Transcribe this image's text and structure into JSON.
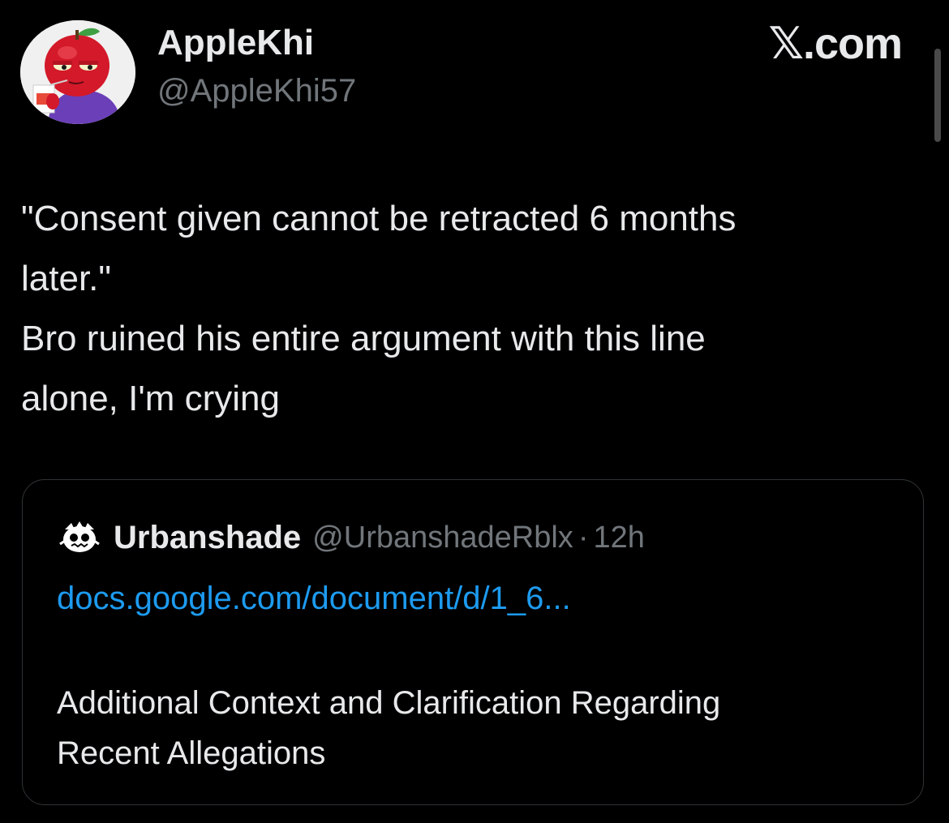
{
  "watermark": "𝕏.com",
  "author": {
    "display_name": "AppleKhi",
    "handle": "@AppleKhi57",
    "avatar_icon": "apple-character-avatar"
  },
  "tweet": {
    "lines": [
      "\"Consent given cannot be retracted 6 months",
      "later.\"",
      "Bro ruined his entire argument with this line",
      "alone, I'm crying"
    ]
  },
  "quoted_tweet": {
    "avatar_icon": "urbanshade-logo-avatar",
    "display_name": "Urbanshade",
    "handle": "@UrbanshadeRblx",
    "separator": "·",
    "time": "12h",
    "link": "docs.google.com/document/d/1_6...",
    "body_lines": [
      "Additional Context and Clarification Regarding",
      "Recent Allegations"
    ]
  },
  "colors": {
    "background": "#000000",
    "text": "#e7e9ea",
    "secondary": "#71767b",
    "link": "#1d9bf0",
    "border": "#2f3336"
  }
}
